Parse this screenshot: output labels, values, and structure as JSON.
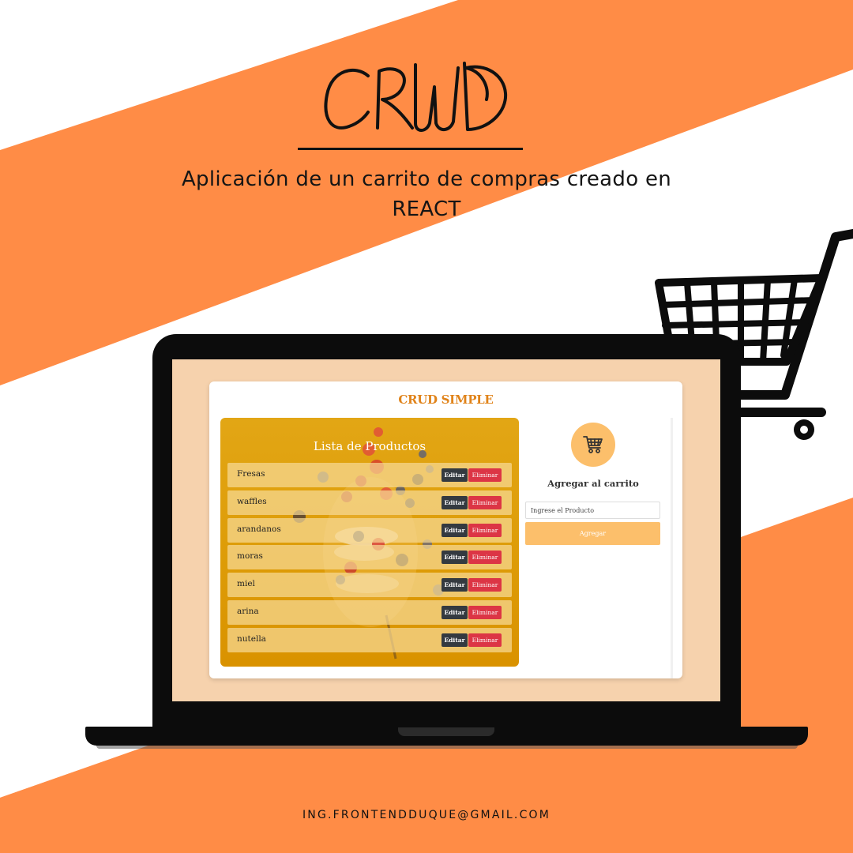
{
  "poster": {
    "script_title": "CRUD",
    "subtitle_line1": "Aplicación de un carrito de compras creado en",
    "subtitle_line2": "REACT",
    "email": "ING.FRONTENDDUQUE@GMAIL.COM",
    "colors": {
      "orange_band": "#ff8c46",
      "laptop": "#0c0c0c"
    },
    "icons": [
      "shopping-cart-icon"
    ]
  },
  "app": {
    "title": "CRUD SIMPLE",
    "list_title": "Lista de Productos",
    "edit_label": "Editar",
    "delete_label": "Eliminar",
    "products": [
      "Fresas",
      "waffles",
      "arandanos",
      "moras",
      "miel",
      "arina",
      "nutella"
    ],
    "form": {
      "title": "Agregar al carrito",
      "input_placeholder": "Ingrese el Producto",
      "input_value": "",
      "submit_label": "Agregar"
    },
    "colors": {
      "title": "#e0831a",
      "panel": "#dd9b06",
      "edit": "#343a40",
      "delete": "#dc3545",
      "accent": "#fcbf6b",
      "screen_bg": "#f6d2ad"
    },
    "icons": [
      "cart-icon"
    ]
  }
}
